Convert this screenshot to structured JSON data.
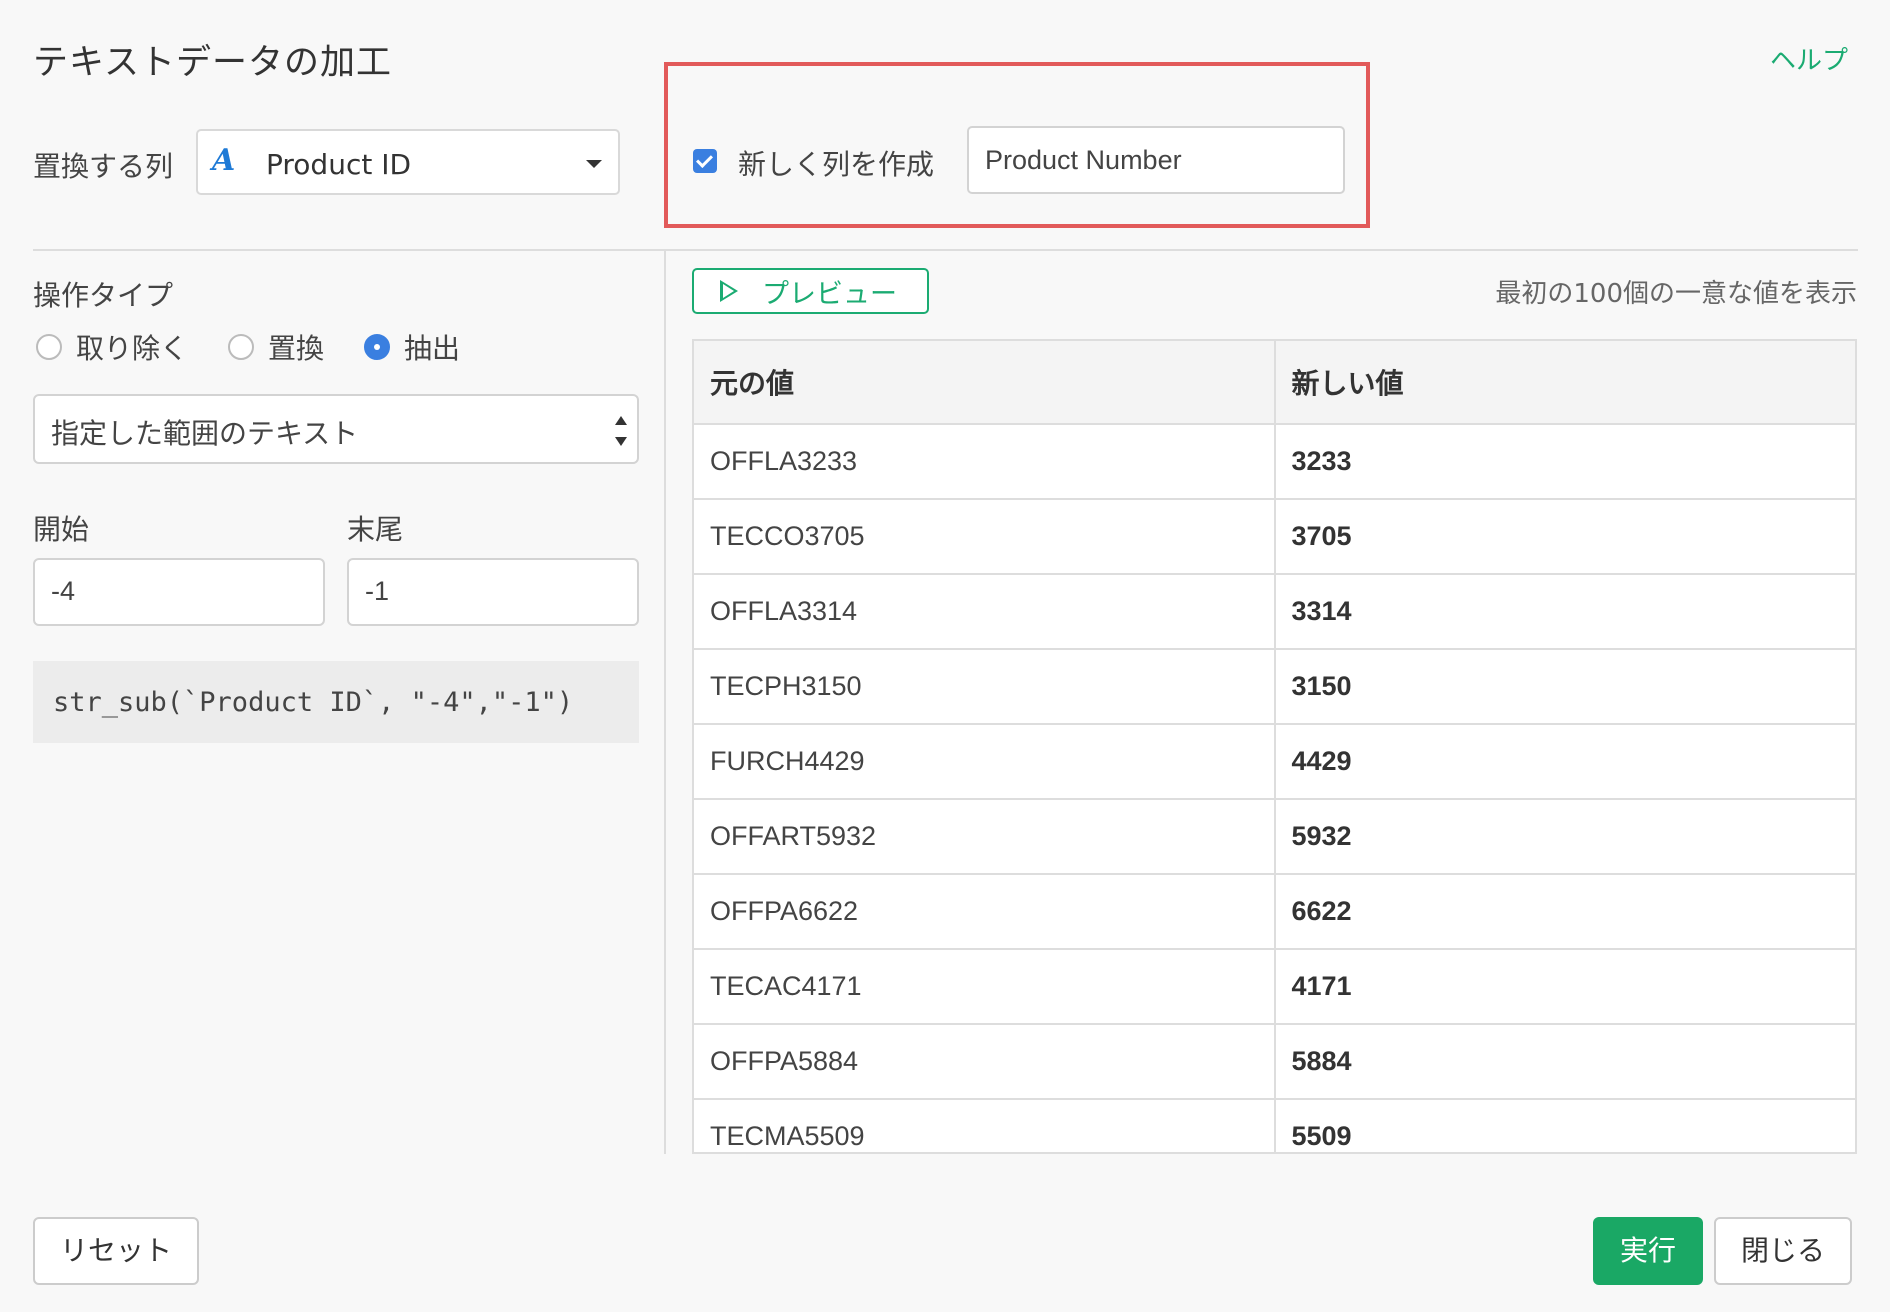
{
  "header": {
    "title": "テキストデータの加工",
    "help_label": "ヘルプ"
  },
  "column": {
    "label": "置換する列",
    "type_icon": "A",
    "selected": "Product ID"
  },
  "new_column": {
    "checked": true,
    "label": "新しく列を作成",
    "name": "Product Number"
  },
  "operation": {
    "label": "操作タイプ",
    "options": [
      {
        "label": "取り除く",
        "selected": false
      },
      {
        "label": "置換",
        "selected": false
      },
      {
        "label": "抽出",
        "selected": true
      }
    ],
    "range_type": "指定した範囲のテキスト",
    "start_label": "開始",
    "end_label": "末尾",
    "start_value": "-4",
    "end_value": "-1",
    "code": "str_sub(`Product ID`, \"-4\",\"-1\")"
  },
  "preview": {
    "button_label": "プレビュー",
    "note": "最初の100個の一意な値を表示",
    "columns": [
      "元の値",
      "新しい値"
    ],
    "rows": [
      [
        "OFFLA3233",
        "3233"
      ],
      [
        "TECCO3705",
        "3705"
      ],
      [
        "OFFLA3314",
        "3314"
      ],
      [
        "TECPH3150",
        "3150"
      ],
      [
        "FURCH4429",
        "4429"
      ],
      [
        "OFFART5932",
        "5932"
      ],
      [
        "OFFPA6622",
        "6622"
      ],
      [
        "TECAC4171",
        "4171"
      ],
      [
        "OFFPA5884",
        "5884"
      ],
      [
        "TECMA5509",
        "5509"
      ]
    ]
  },
  "footer": {
    "reset_label": "リセット",
    "run_label": "実行",
    "close_label": "閉じる"
  },
  "colors": {
    "accent_green": "#1bab72",
    "run_button": "#1aa865",
    "highlight_red": "#e25a5a",
    "checkbox_blue": "#3a7fe0",
    "type_icon_blue": "#1e7ad6"
  }
}
